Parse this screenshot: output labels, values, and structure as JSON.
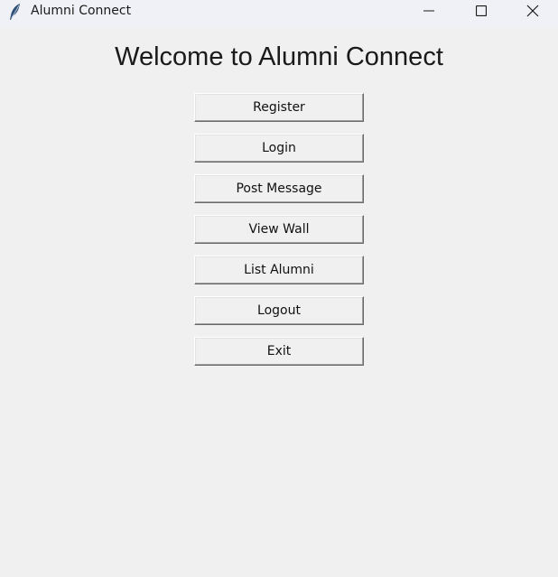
{
  "window": {
    "title": "Alumni Connect",
    "app_icon": "feather-icon",
    "controls": {
      "minimize_icon": "minimize-icon",
      "maximize_icon": "maximize-icon",
      "close_icon": "close-icon"
    }
  },
  "main": {
    "heading": "Welcome to Alumni Connect",
    "buttons": [
      {
        "label": "Register"
      },
      {
        "label": "Login"
      },
      {
        "label": "Post Message"
      },
      {
        "label": "View Wall"
      },
      {
        "label": "List Alumni"
      },
      {
        "label": "Logout"
      },
      {
        "label": "Exit"
      }
    ]
  },
  "colors": {
    "background": "#f0f0f0",
    "titlebar": "#eff1f6",
    "text": "#1a1a1a"
  }
}
